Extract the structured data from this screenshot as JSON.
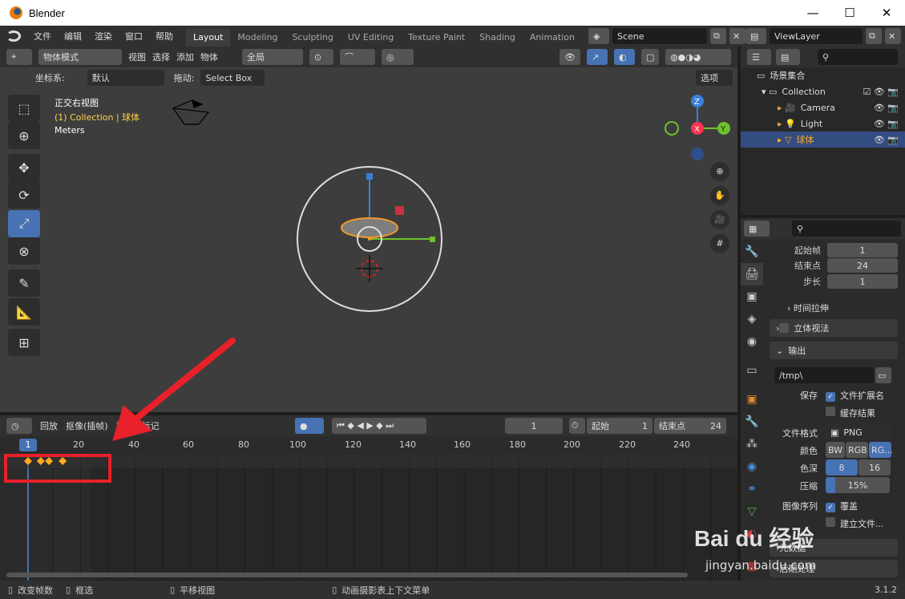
{
  "window": {
    "title": "Blender",
    "minimize": "—",
    "maximize": "☐",
    "close": "✕"
  },
  "menu": [
    "文件",
    "编辑",
    "渲染",
    "窗口",
    "帮助"
  ],
  "workspaces": [
    "Layout",
    "Modeling",
    "Sculpting",
    "UV Editing",
    "Texture Paint",
    "Shading",
    "Animation",
    "Re"
  ],
  "scene": {
    "label": "Scene",
    "viewlayer": "ViewLayer"
  },
  "viewport": {
    "mode": "物体模式",
    "menus": [
      "视图",
      "选择",
      "添加",
      "物体"
    ],
    "orientation": "全局",
    "coord_label": "坐标系:",
    "coord_value": "默认",
    "drag_label": "拖动:",
    "drag_value": "Select Box",
    "options": "选项",
    "overlay_title": "正交右视图",
    "overlay_collection": "(1) Collection | 球体",
    "overlay_units": "Meters",
    "gizmo": {
      "z": "Z",
      "x": "X",
      "y": "Y"
    }
  },
  "timeline": {
    "menus": [
      "回放",
      "抠像(插帧)",
      "视图",
      "标记"
    ],
    "current_frame": "1",
    "start_label": "起始",
    "start": "1",
    "end_label": "结束点",
    "end": "24",
    "ruler": [
      "1",
      "20",
      "40",
      "60",
      "80",
      "100",
      "120",
      "140",
      "160",
      "180",
      "200",
      "220",
      "240"
    ],
    "keyframes": [
      0,
      2,
      5,
      10
    ]
  },
  "status": {
    "s1": "改变帧数",
    "s2": "框选",
    "s3": "平移视图",
    "s4": "动画摄影表上下文菜单",
    "version": "3.1.2"
  },
  "outliner": {
    "root": "场景集合",
    "items": [
      "Collection",
      "Camera",
      "Light",
      "球体"
    ]
  },
  "properties": {
    "frame_start_label": "起始帧",
    "frame_start": "1",
    "frame_end_label": "结束点",
    "frame_end": "24",
    "step_label": "步长",
    "step": "1",
    "time_stretch": "时间拉伸",
    "stereo": "立体视法",
    "output": "输出",
    "path": "/tmp\\",
    "save_label": "保存",
    "file_ext": "文件扩展名",
    "cache": "缓存结果",
    "format_label": "文件格式",
    "format": "PNG",
    "color_label": "颜色",
    "color_opts": [
      "BW",
      "RGB",
      "RG..."
    ],
    "depth_label": "色深",
    "depth_opts": [
      "8",
      "16"
    ],
    "compress_label": "压缩",
    "compress": "15%",
    "seq_label": "图像序列",
    "overwrite": "覆盖",
    "placeholder": "建立文件...",
    "meta": "元数据",
    "post": "后期处理"
  },
  "watermark": {
    "brand": "Bai du 经验",
    "url": "jingyan.baidu.com"
  },
  "colors": {
    "accent": "#4772b3",
    "orange": "#ffa91f",
    "arrow": "#e8202a"
  }
}
